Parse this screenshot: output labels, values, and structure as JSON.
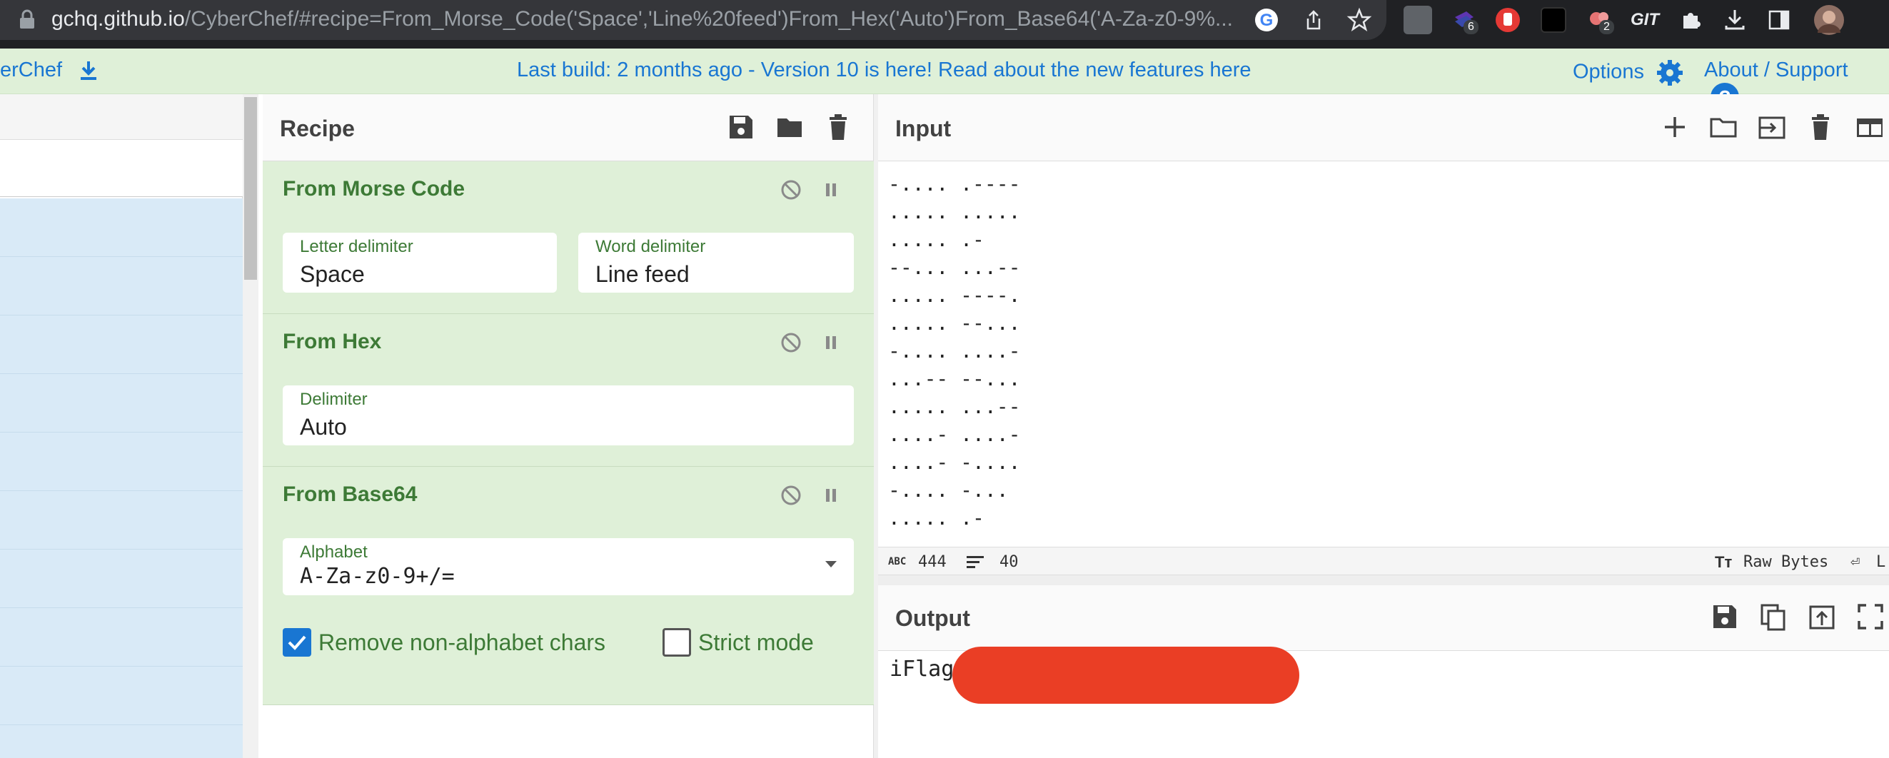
{
  "browser": {
    "url_host": "gchq.github.io",
    "url_path": "/CyberChef/#recipe=From_Morse_Code('Space','Line%20feed')From_Hex('Auto')From_Base64('A-Za-z0-9%...",
    "ext_badge_1": "6",
    "ext_badge_2": "2",
    "ext_label_git": "GIT"
  },
  "banner": {
    "left_text": "erChef",
    "center_text": "Last build: 2 months ago - Version 10 is here! Read about the new features here",
    "options_label": "Options",
    "about_label": "About / Support"
  },
  "recipe": {
    "title": "Recipe",
    "ops": [
      {
        "name": "From Morse Code",
        "fields": [
          {
            "label": "Letter delimiter",
            "value": "Space"
          },
          {
            "label": "Word delimiter",
            "value": "Line feed"
          }
        ]
      },
      {
        "name": "From Hex",
        "fields": [
          {
            "label": "Delimiter",
            "value": "Auto"
          }
        ]
      },
      {
        "name": "From Base64",
        "fields": [
          {
            "label": "Alphabet",
            "value": "A-Za-z0-9+/="
          }
        ],
        "checkboxes": [
          {
            "label": "Remove non-alphabet chars",
            "checked": true
          },
          {
            "label": "Strict mode",
            "checked": false
          }
        ]
      }
    ]
  },
  "input": {
    "title": "Input",
    "lines": "-.... .----\n..... .....\n..... .-\n--... ...--\n..... ----.\n..... --...\n-.... ....-\n...-- --...\n..... ...--\n....- ....-\n....- -....\n-.... -...\n..... .-",
    "stats": {
      "chars_label": "ABC",
      "chars": "444",
      "lines": "40",
      "format": "Raw Bytes",
      "eol": "L"
    }
  },
  "output": {
    "title": "Output",
    "text": "iFlag"
  },
  "colors": {
    "accent": "#1976d2",
    "op_bg": "#dff0d8",
    "op_text": "#3d7a36",
    "redaction": "#ea3e25"
  }
}
